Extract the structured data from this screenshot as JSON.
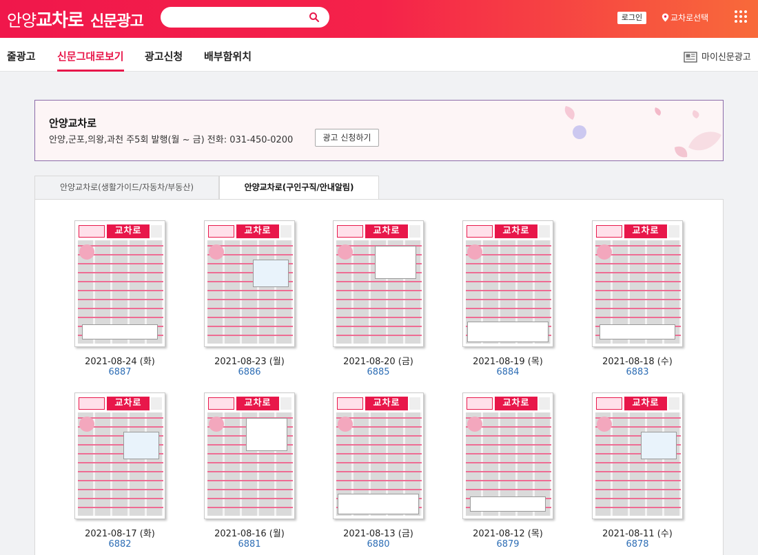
{
  "header": {
    "logo_part1": "안양",
    "logo_part2": "교차로",
    "logo_part3": "신문광고",
    "search_placeholder": "",
    "login_label": "로그인",
    "region_label": "교차로선택"
  },
  "nav": {
    "tabs": [
      "줄광고",
      "신문그대로보기",
      "광고신청",
      "배부함위치"
    ],
    "my_paper_label": "마이신문광고"
  },
  "banner": {
    "title": "안양교차로",
    "info": "안양,군포,의왕,과천 주5회 발행(월 ~ 금) 전화: 031-450-0200",
    "apply_label": "광고 신청하기"
  },
  "tabs": [
    "안양교차로(생활가이드/자동차/부동산)",
    "안양교차로(구인구직/안내알림)"
  ],
  "paper_thumb_title": "교차로",
  "issues": [
    {
      "date": "2021-08-24 (화)",
      "number": "6887"
    },
    {
      "date": "2021-08-23 (월)",
      "number": "6886"
    },
    {
      "date": "2021-08-20 (금)",
      "number": "6885"
    },
    {
      "date": "2021-08-19 (목)",
      "number": "6884"
    },
    {
      "date": "2021-08-18 (수)",
      "number": "6883"
    },
    {
      "date": "2021-08-17 (화)",
      "number": "6882"
    },
    {
      "date": "2021-08-16 (월)",
      "number": "6881"
    },
    {
      "date": "2021-08-13 (금)",
      "number": "6880"
    },
    {
      "date": "2021-08-12 (목)",
      "number": "6879"
    },
    {
      "date": "2021-08-11 (수)",
      "number": "6878"
    }
  ]
}
